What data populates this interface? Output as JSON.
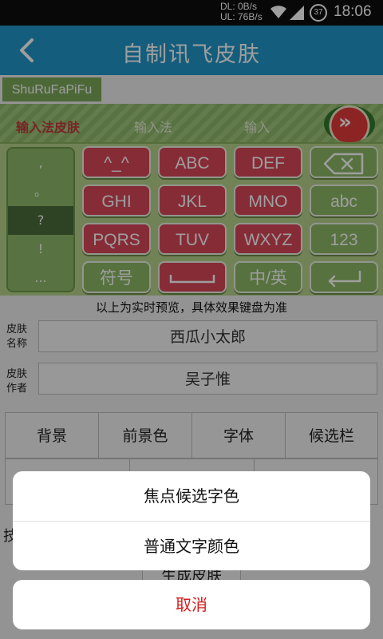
{
  "status_bar": {
    "download_speed": "DL: 0B/s",
    "upload_speed": "UL: 76B/s",
    "battery": "37",
    "time": "18:06"
  },
  "header": {
    "title": "自制讯飞皮肤"
  },
  "skin_tag": "ShuRuFaPiFu",
  "keyboard_preview": {
    "tabs": [
      "输入法皮肤",
      "输入法",
      "输入"
    ],
    "candidates": [
      ",",
      "。",
      "?",
      "!",
      "..."
    ],
    "keys": {
      "r1": [
        "^_^",
        "ABC",
        "DEF"
      ],
      "r2": [
        "GHI",
        "JKL",
        "MNO",
        "abc"
      ],
      "r3": [
        "PQRS",
        "TUV",
        "WXYZ",
        "123"
      ],
      "r4": [
        "符号",
        "中/英"
      ]
    },
    "colors": {
      "key_red": "#d9485a",
      "key_green": "#8db866",
      "background": "#b6d38c"
    }
  },
  "preview_note": "以上为实时预览，具体效果键盘为准",
  "form": {
    "skin_name_label": "皮肤\n名称",
    "skin_name_value": "西瓜小太郎",
    "skin_author_label": "皮肤\n作者",
    "skin_author_value": "吴子惟"
  },
  "tools": [
    "背景",
    "前景色",
    "字体",
    "候选栏"
  ],
  "behind": {
    "partial_left": "技",
    "generate_button": "生成皮肤"
  },
  "action_sheet": {
    "options": [
      "焦点候选字色",
      "普通文字颜色"
    ],
    "cancel": "取消"
  },
  "colors": {
    "header": "#2196c8",
    "cancel_text": "#d11e1e"
  }
}
